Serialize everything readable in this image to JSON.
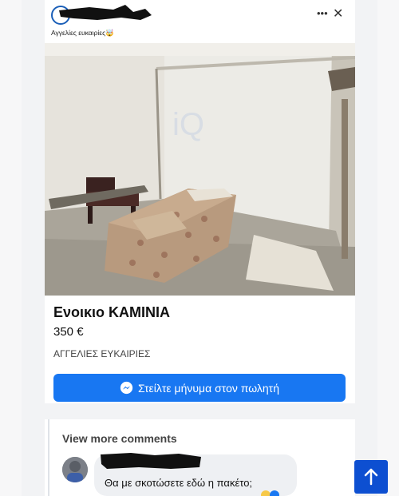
{
  "post": {
    "group_name": "Αγγελίες ευκαιρίες🤯",
    "more_icon": "more-horizontal-icon",
    "close_icon": "close-icon",
    "more_symbol": "•••",
    "close_symbol": "✕"
  },
  "listing": {
    "title": "Ενοικιο ΚΑΜΙΝΙΑ",
    "price": "350 €",
    "category": "ΑΓΓΕΛΙΕΣ ΕΥΚΑΙΡΙΕΣ",
    "button_label": "Στείλτε μήνυμα στον πωλητή",
    "button_icon": "messenger-icon"
  },
  "comments": {
    "view_more": "View more comments",
    "items": [
      {
        "text": "Θα με σκοτώσετε εδώ η πακέτο;"
      }
    ]
  },
  "scroll_top": {
    "icon": "arrow-up-icon"
  },
  "colors": {
    "accent": "#1877f2",
    "scroll_button": "#0d4fd1"
  }
}
